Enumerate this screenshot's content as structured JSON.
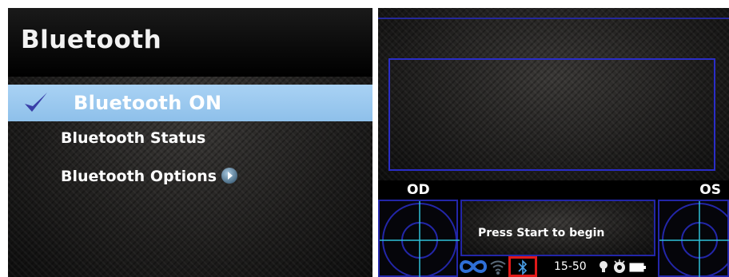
{
  "left_panel": {
    "title": "Bluetooth",
    "menu": [
      {
        "label": "Bluetooth ON",
        "selected": true,
        "checked": true
      },
      {
        "label": "Bluetooth Status",
        "selected": false
      },
      {
        "label": "Bluetooth Options",
        "selected": false,
        "has_submenu": true
      }
    ]
  },
  "right_panel": {
    "left_eye_label": "OD",
    "right_eye_label": "OS",
    "message": "Press Start to begin",
    "status_bar": {
      "time": "15-50",
      "icons": [
        "infinity-icon",
        "wifi-icon",
        "bluetooth-icon",
        "bulb-icon",
        "eye-icon",
        "battery-icon"
      ],
      "bluetooth_highlight_color": "#e01919"
    }
  },
  "colors": {
    "selection": "#9dcaef",
    "accent_blue": "#2a2dc8",
    "background": "#1a1918"
  }
}
